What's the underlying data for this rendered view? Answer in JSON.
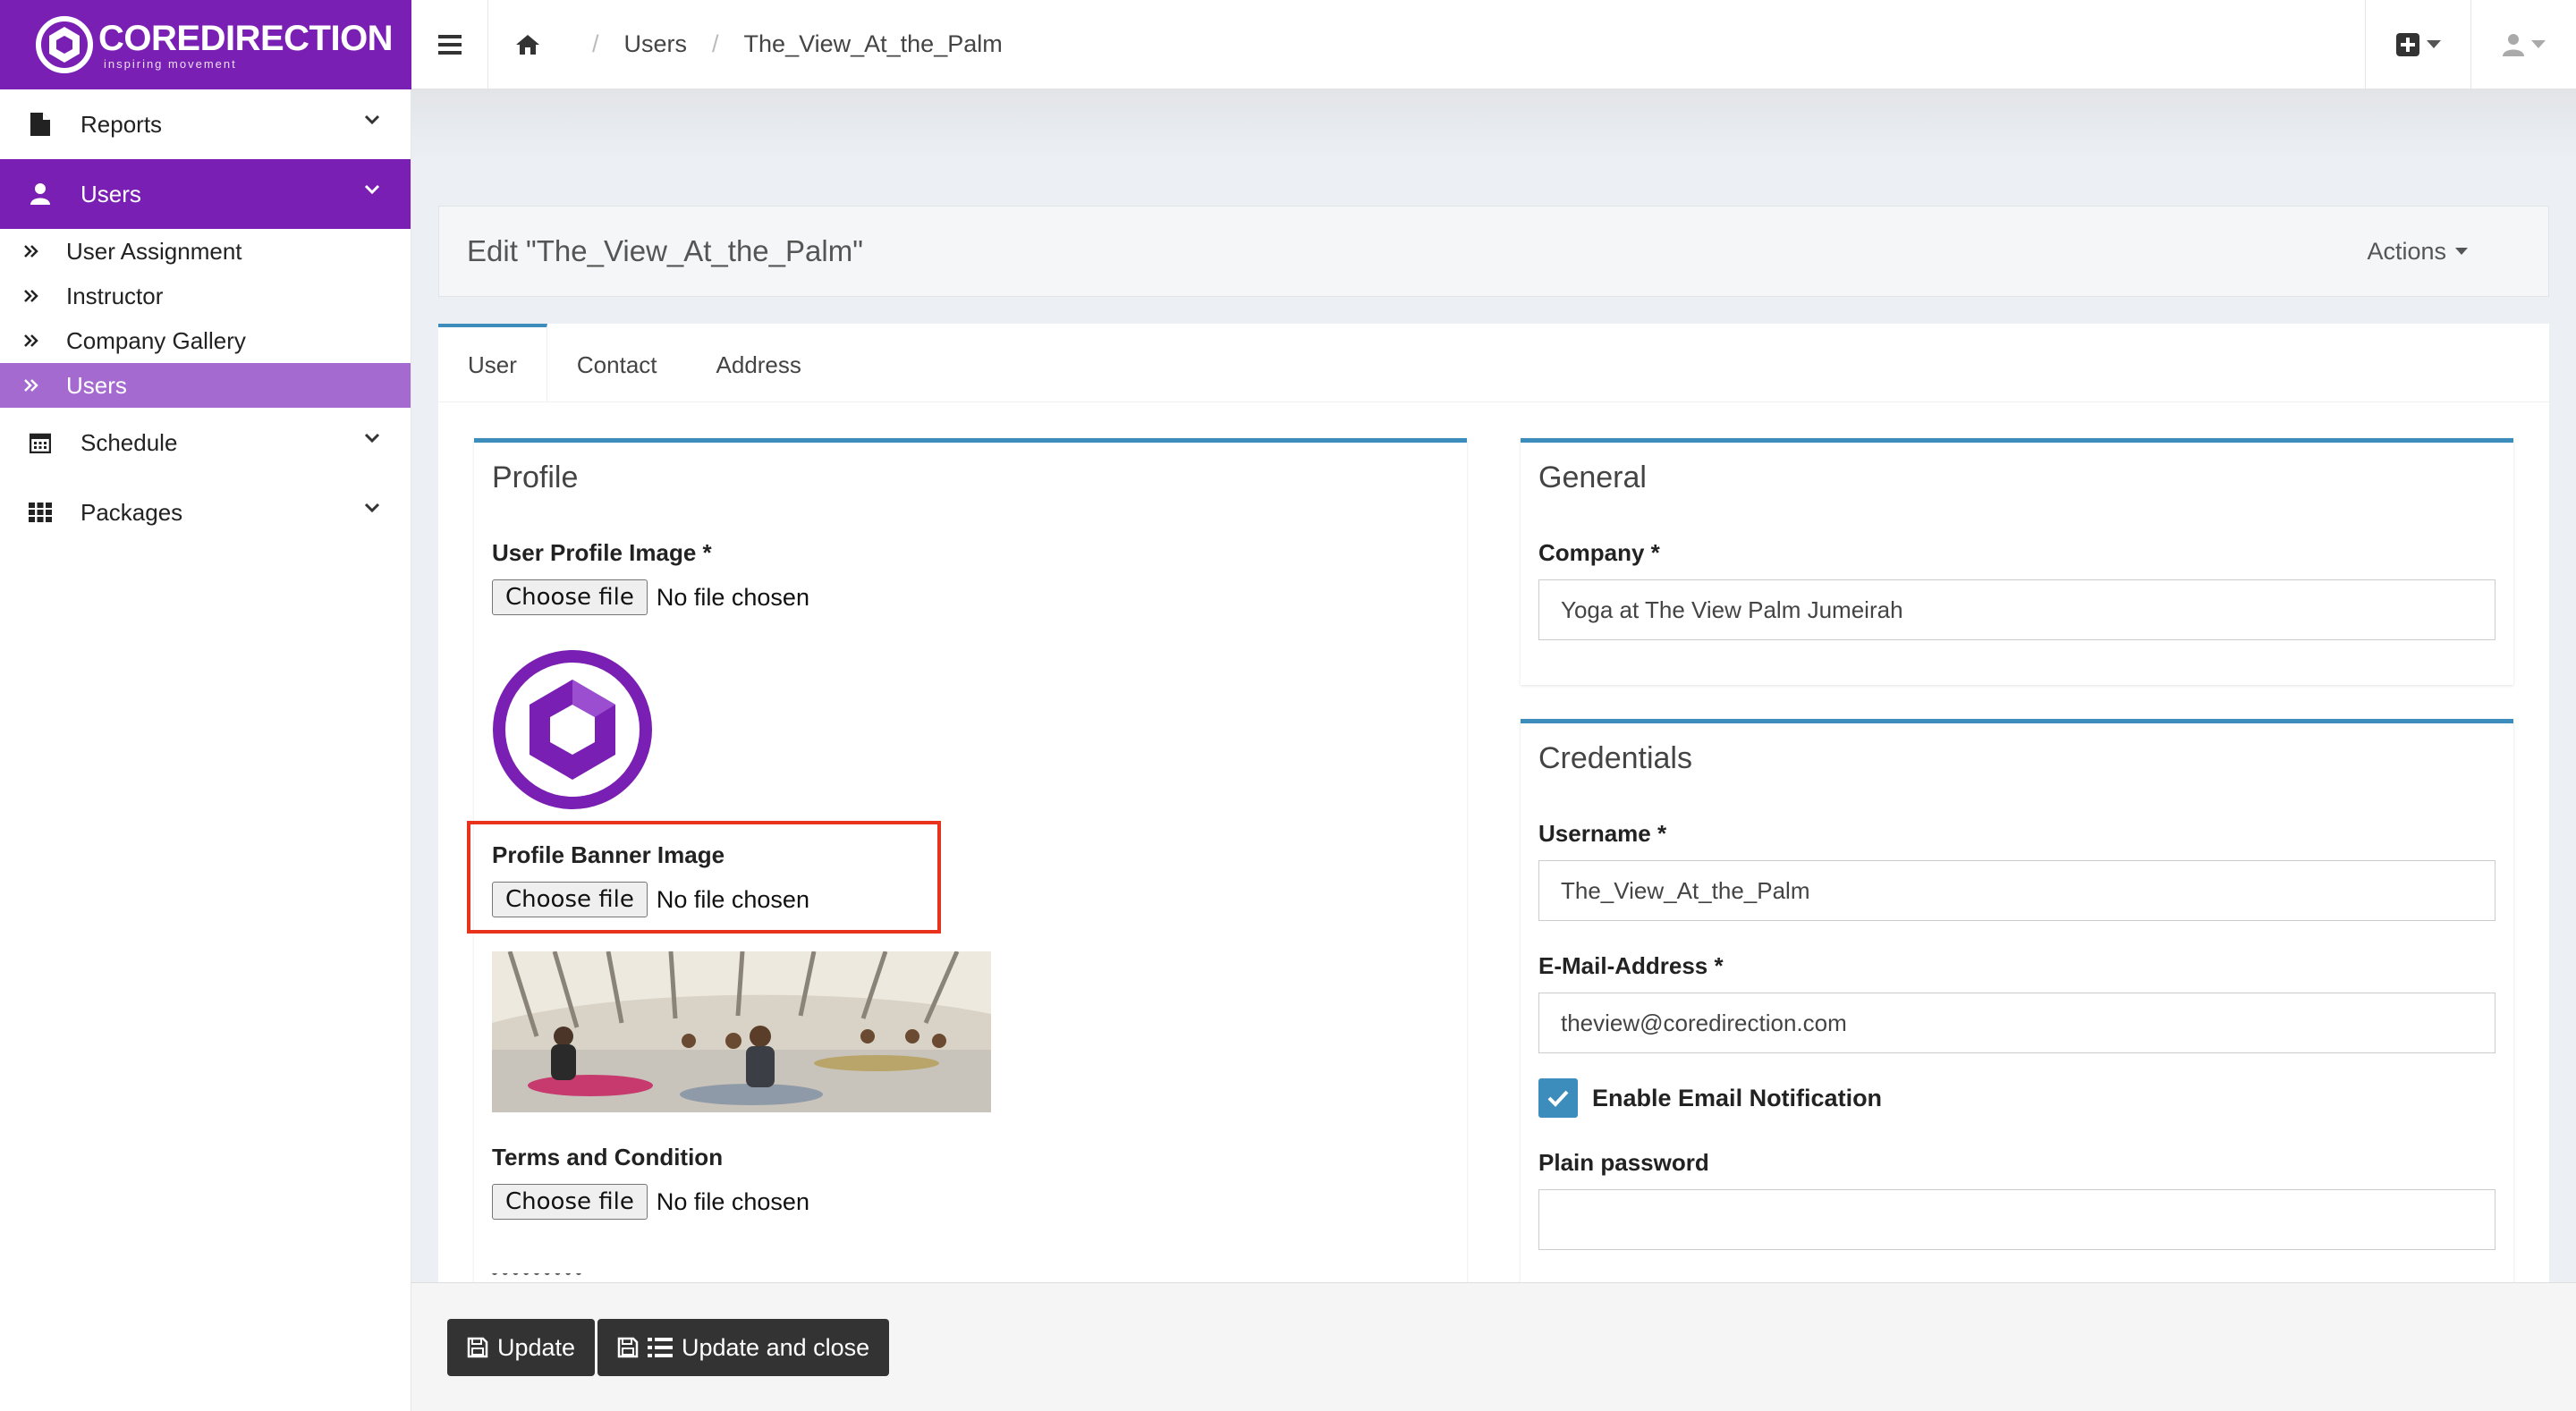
{
  "brand": {
    "name": "COREDIRECTION",
    "tagline": "inspiring movement",
    "color": "#7a1fb3"
  },
  "breadcrumb": {
    "items": [
      "Users",
      "The_View_At_the_Palm"
    ]
  },
  "sidebar": {
    "items": [
      {
        "label": "Reports",
        "icon": "file-icon"
      },
      {
        "label": "Users",
        "icon": "user-icon",
        "active": true
      },
      {
        "label": "Schedule",
        "icon": "calendar-icon"
      },
      {
        "label": "Packages",
        "icon": "grid-icon"
      }
    ],
    "subitems": [
      "User Assignment",
      "Instructor",
      "Company Gallery",
      "Users"
    ]
  },
  "page": {
    "title": "Edit \"The_View_At_the_Palm\"",
    "actions_label": "Actions"
  },
  "tabs": [
    "User",
    "Contact",
    "Address"
  ],
  "profile": {
    "title": "Profile",
    "profile_image_label": "User Profile Image *",
    "banner_image_label": "Profile Banner Image",
    "terms_label": "Terms and Condition",
    "choose_file": "Choose file",
    "no_file": "No file chosen"
  },
  "general": {
    "title": "General",
    "company_label": "Company *",
    "company_value": "Yoga at The View Palm Jumeirah"
  },
  "credentials": {
    "title": "Credentials",
    "username_label": "Username *",
    "username_value": "The_View_At_the_Palm",
    "email_label": "E-Mail-Address *",
    "email_value": "theview@coredirection.com",
    "notify_label": "Enable Email Notification",
    "notify_checked": true,
    "password_label": "Plain password",
    "password_value": ""
  },
  "footer": {
    "update_label": "Update",
    "update_close_label": "Update and close"
  },
  "colors": {
    "accent": "#3c8dbc",
    "sidebar_active": "#7a1fb3",
    "sub_active": "#a56ad0",
    "highlight": "#e8321c"
  }
}
